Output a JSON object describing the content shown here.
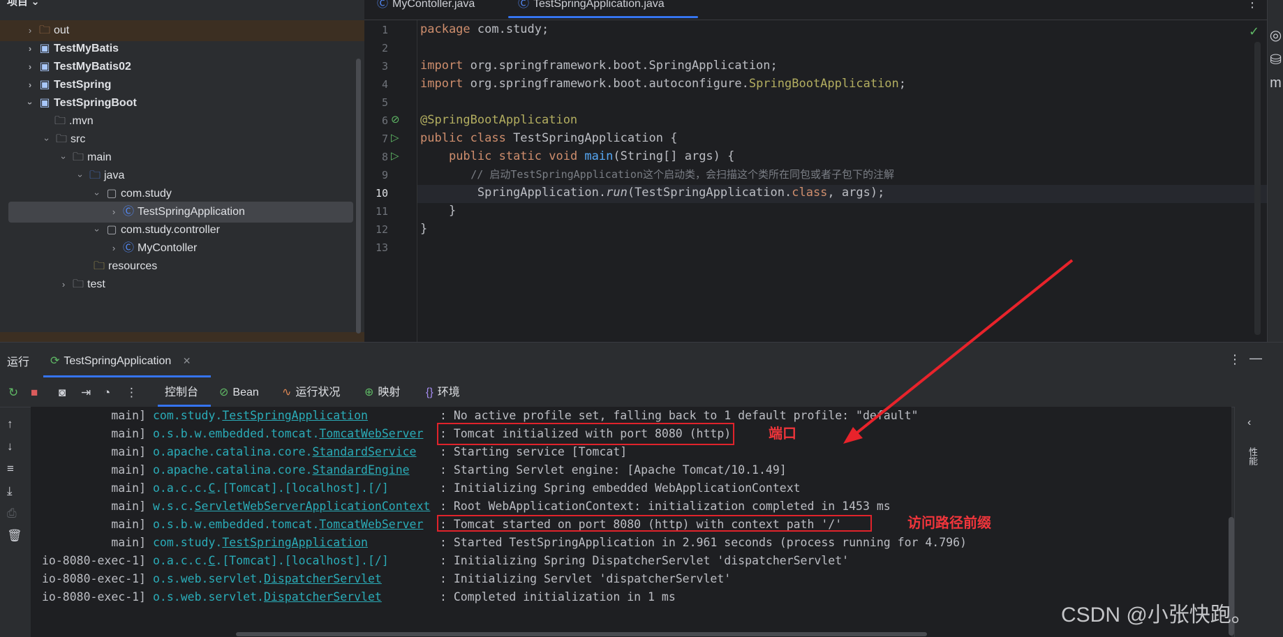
{
  "project": {
    "header": "项目",
    "items": [
      {
        "label": "out",
        "kind": "folder-orange",
        "expanded": false
      },
      {
        "label": "TestMyBatis",
        "kind": "module",
        "expanded": false
      },
      {
        "label": "TestMyBatis02",
        "kind": "module",
        "expanded": false
      },
      {
        "label": "TestSpring",
        "kind": "module",
        "expanded": false
      },
      {
        "label": "TestSpringBoot",
        "kind": "module",
        "expanded": true
      },
      {
        "label": ".mvn",
        "kind": "folder"
      },
      {
        "label": "src",
        "kind": "folder",
        "expanded": true
      },
      {
        "label": "main",
        "kind": "folder",
        "expanded": true
      },
      {
        "label": "java",
        "kind": "folder-blue",
        "expanded": true
      },
      {
        "label": "com.study",
        "kind": "package",
        "expanded": true
      },
      {
        "label": "TestSpringApplication",
        "kind": "class-spring",
        "selected": true
      },
      {
        "label": "com.study.controller",
        "kind": "package",
        "expanded": true
      },
      {
        "label": "MyContoller",
        "kind": "class"
      },
      {
        "label": "resources",
        "kind": "folder-res"
      },
      {
        "label": "test",
        "kind": "folder",
        "expanded": false
      }
    ]
  },
  "editor": {
    "tabs": [
      {
        "label": "MyContoller.java",
        "active": false
      },
      {
        "label": "TestSpringApplication.java",
        "active": true
      }
    ],
    "line_numbers": [
      "1",
      "2",
      "3",
      "4",
      "5",
      "6",
      "7",
      "8",
      "9",
      "10",
      "11",
      "12",
      "13"
    ],
    "code": {
      "l1_kw": "package",
      "l1_rest": " com.study;",
      "l3_kw": "import",
      "l3_rest": " org.springframework.boot.SpringApplication;",
      "l4_kw": "import",
      "l4_rest": " org.springframework.boot.autoconfigure.",
      "l4_ann": "SpringBootApplication",
      "l4_end": ";",
      "l6_ann": "@SpringBootApplication",
      "l7_kw": "public class",
      "l7_rest": " TestSpringApplication {",
      "l8_indent": "    ",
      "l8_kw": "public static void",
      "l8_fn": " main",
      "l8_rest": "(String[] args) {",
      "l9_comment": "        // 启动TestSpringApplication这个启动类，会扫描这个类所在同包或者子包下的注解",
      "l10_a": "        SpringApplication.",
      "l10_run": "run",
      "l10_b": "(TestSpringApplication.",
      "l10_class": "class",
      "l10_c": ", args);",
      "l11": "    }",
      "l12": "}"
    }
  },
  "run": {
    "title": "运行",
    "tab_label": "TestSpringApplication",
    "subtabs": [
      "控制台",
      "Bean",
      "运行状况",
      "映射",
      "环境"
    ],
    "log": [
      {
        "thread": "main]",
        "pkg": "com.study.",
        "cls": "TestSpringApplication",
        "msg": ": No active profile set, falling back to 1 default profile: \"default\""
      },
      {
        "thread": "main]",
        "pkg": "o.s.b.w.embedded.tomcat.",
        "cls": "TomcatWebServer",
        "msg": ": Tomcat initialized with port 8080 (http)"
      },
      {
        "thread": "main]",
        "pkg": "o.apache.catalina.core.",
        "cls": "StandardService",
        "msg": ": Starting service [Tomcat]"
      },
      {
        "thread": "main]",
        "pkg": "o.apache.catalina.core.",
        "cls": "StandardEngine",
        "msg": ": Starting Servlet engine: [Apache Tomcat/10.1.49]"
      },
      {
        "thread": "main]",
        "pkg": "o.a.c.c.",
        "cls": "C",
        "rest": ".[Tomcat].[localhost].[/]",
        "msg": ": Initializing Spring embedded WebApplicationContext"
      },
      {
        "thread": "main]",
        "pkg": "w.s.c.",
        "cls": "ServletWebServerApplicationContext",
        "msg": ": Root WebApplicationContext: initialization completed in 1453 ms"
      },
      {
        "thread": "main]",
        "pkg": "o.s.b.w.embedded.tomcat.",
        "cls": "TomcatWebServer",
        "msg": ": Tomcat started on port 8080 (http) with context path '/'"
      },
      {
        "thread": "main]",
        "pkg": "com.study.",
        "cls": "TestSpringApplication",
        "msg": ": Started TestSpringApplication in 2.961 seconds (process running for 4.796)"
      },
      {
        "thread": "io-8080-exec-1]",
        "pkg": "o.a.c.c.",
        "cls": "C",
        "rest": ".[Tomcat].[localhost].[/]",
        "msg": ": Initializing Spring DispatcherServlet 'dispatcherServlet'"
      },
      {
        "thread": "io-8080-exec-1]",
        "pkg": "o.s.web.servlet.",
        "cls": "DispatcherServlet",
        "msg": ": Initializing Servlet 'dispatcherServlet'"
      },
      {
        "thread": "io-8080-exec-1]",
        "pkg": "o.s.web.servlet.",
        "cls": "DispatcherServlet",
        "msg": ": Completed initialization in 1 ms"
      }
    ],
    "annotations": {
      "port": "端口",
      "prefix": "访问路径前缀"
    },
    "right_panel_label": "性能"
  },
  "watermark": "CSDN @小张快跑。",
  "colors": {
    "keyword": "#cf8e6d",
    "annotation": "#b3ae60",
    "function": "#56a8f5",
    "logger": "#2aacb8",
    "highlight": "#e0232b",
    "accent": "#3574f0"
  }
}
